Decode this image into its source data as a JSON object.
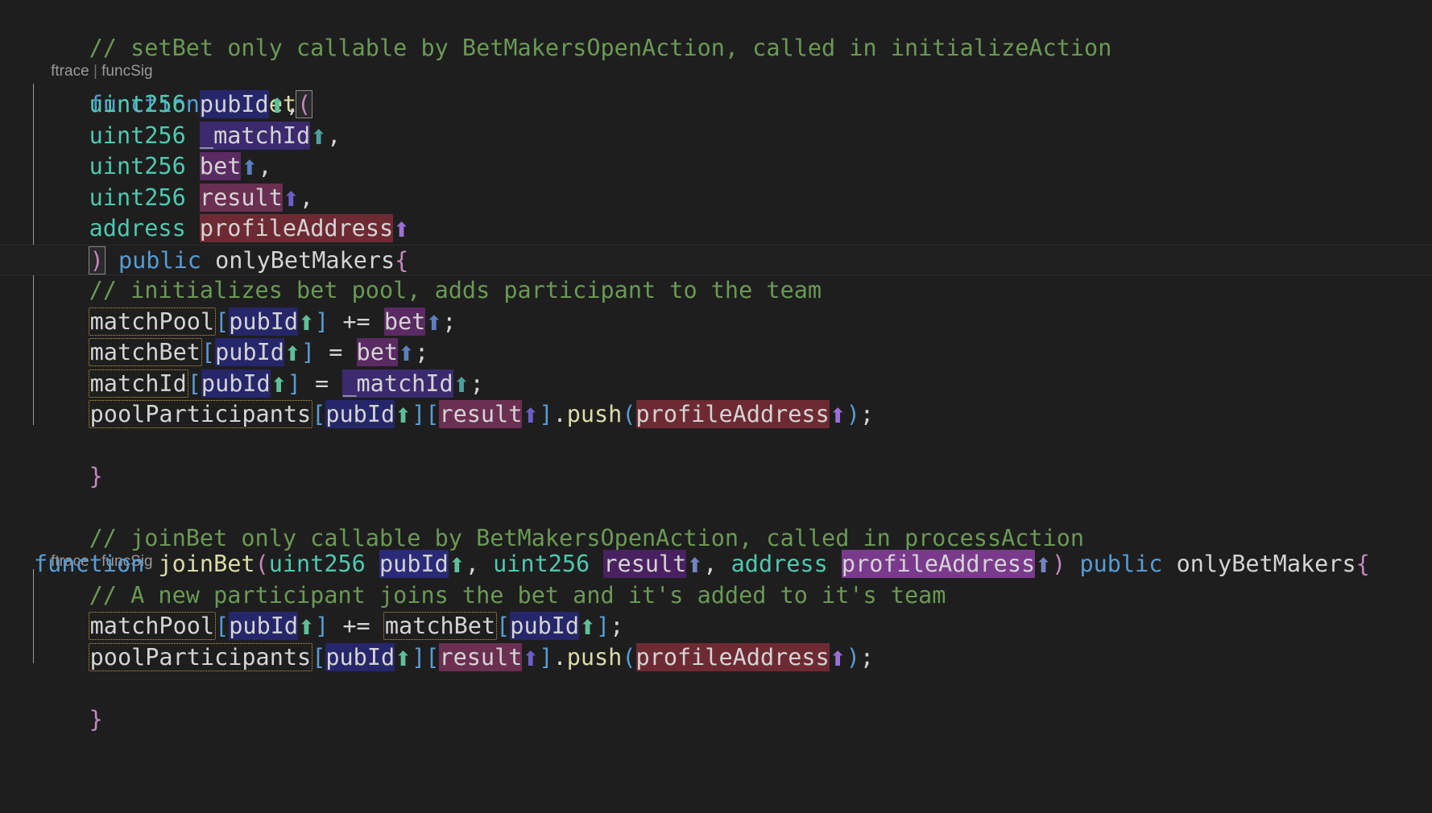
{
  "editor": {
    "language": "solidity",
    "background": "#1e1e1e",
    "foreground": "#d4d4d4",
    "font_size_px": 28,
    "line_height_px": 38
  },
  "colors": {
    "comment": "#6A9955",
    "keyword": "#569CD6",
    "function": "#DCDCAA",
    "type": "#4EC9B0",
    "identifier": "#D4D4D4",
    "bracket_pink": "#C586C0",
    "bracket_blue": "#569CD6",
    "statevar_border": "#c8a050",
    "codelens": "#9a9a9a",
    "indent_guide_active": "#9b9b9b"
  },
  "codelens": {
    "first": "ftrace",
    "separator": "|",
    "second": "funcSig"
  },
  "lines": {
    "l1_comment": "// setBet only callable by BetMakersOpenAction, called in initializeAction",
    "l3_function_kw": "function",
    "l3_name": "setBet",
    "l3_open_paren": "(",
    "p1_type": "uint256",
    "p1_name": "pubId",
    "p1_arrow": "arrow-up-icon",
    "p1_comma": ",",
    "p2_type": "uint256",
    "p2_name": "_matchId",
    "p2_arrow": "arrow-up-icon",
    "p2_comma": ",",
    "p3_type": "uint256",
    "p3_name": "bet",
    "p3_arrow": "arrow-up-icon",
    "p3_comma": ",",
    "p4_type": "uint256",
    "p4_name": "result",
    "p4_arrow": "arrow-up-icon",
    "p4_comma": ",",
    "p5_type": "address",
    "p5_name": "profileAddress",
    "p5_arrow": "arrow-up-icon",
    "close_paren": ")",
    "visibility": "public",
    "modifier": "onlyBetMakers",
    "open_brace": "{",
    "body_comment_1": "// initializes bet pool, adds participant to the team",
    "s1_var": "matchPool",
    "s1_lb": "[",
    "s1_key": "pubId",
    "s1_rb": "]",
    "s1_op": "+=",
    "s1_rhs": "bet",
    "s1_semi": ";",
    "s2_var": "matchBet",
    "s2_lb": "[",
    "s2_key": "pubId",
    "s2_rb": "]",
    "s2_op": "=",
    "s2_rhs": "bet",
    "s2_semi": ";",
    "s3_var": "matchId",
    "s3_lb": "[",
    "s3_key": "pubId",
    "s3_rb": "]",
    "s3_op": "=",
    "s3_rhs": "_matchId",
    "s3_semi": ";",
    "s4_var": "poolParticipants",
    "s4_lb1": "[",
    "s4_key1": "pubId",
    "s4_rb1": "]",
    "s4_lb2": "[",
    "s4_key2": "result",
    "s4_rb2": "]",
    "s4_dot": ".",
    "s4_method": "push",
    "s4_lparen": "(",
    "s4_arg": "profileAddress",
    "s4_rparen": ")",
    "s4_semi": ";",
    "close_brace": "}",
    "l2_comment": "// joinBet only callable by BetMakersOpenAction, called in processAction",
    "j_function_kw": "function",
    "j_name": "joinBet",
    "j_open_paren": "(",
    "j_p1_type": "uint256",
    "j_p1_name": "pubId",
    "j_p1_comma": ",",
    "j_p2_type": "uint256",
    "j_p2_name": "result",
    "j_p2_comma": ",",
    "j_p3_type": "address",
    "j_p3_name": "profileAddress",
    "j_close_paren": ")",
    "j_visibility": "public",
    "j_modifier": "onlyBetMakers",
    "j_open_brace": "{",
    "j_body_comment": "// A new participant joins the bet and it's added to it's team",
    "j_s1_var": "matchPool",
    "j_s1_lb": "[",
    "j_s1_key": "pubId",
    "j_s1_rb": "]",
    "j_s1_op": "+=",
    "j_s1_rvar": "matchBet",
    "j_s1_rlb": "[",
    "j_s1_rkey": "pubId",
    "j_s1_rrb": "]",
    "j_s1_semi": ";",
    "j_s2_var": "poolParticipants",
    "j_s2_lb1": "[",
    "j_s2_key1": "pubId",
    "j_s2_rb1": "]",
    "j_s2_lb2": "[",
    "j_s2_key2": "result",
    "j_s2_rb2": "]",
    "j_s2_dot": ".",
    "j_s2_method": "push",
    "j_s2_lparen": "(",
    "j_s2_arg": "profileAddress",
    "j_s2_rparen": ")",
    "j_s2_semi": ";",
    "j_close_brace": "}"
  },
  "icons": {
    "arrow_up": "⬆"
  }
}
